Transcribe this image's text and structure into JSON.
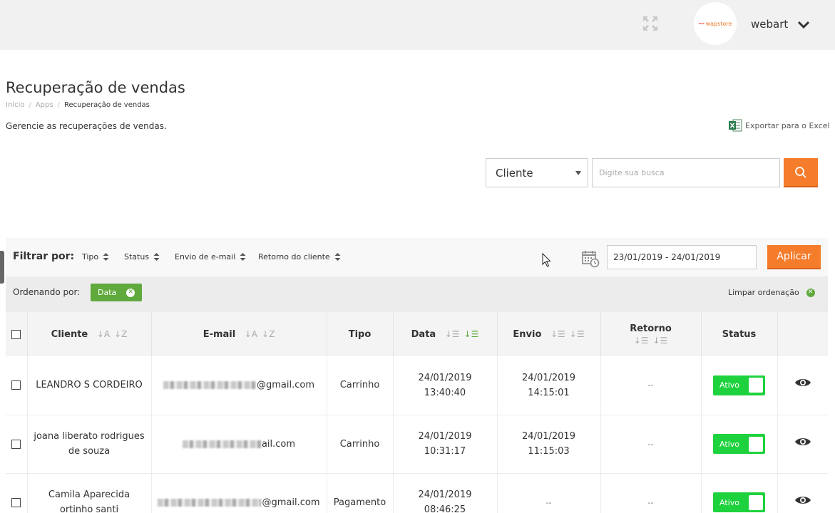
{
  "header": {
    "logo_text": "wapstore",
    "username": "webart"
  },
  "page": {
    "title": "Recuperação de vendas",
    "breadcrumb": [
      "Início",
      "Apps",
      "Recuperação de vendas"
    ],
    "subtitle": "Gerencie as recuperações de vendas.",
    "export_label": "Exportar para o Excel"
  },
  "search": {
    "select_value": "Cliente",
    "placeholder": "Digite sua busca"
  },
  "filters": {
    "label": "Filtrar por:",
    "items": [
      "Tipo",
      "Status",
      "Envio de e-mail",
      "Retorno do cliente"
    ],
    "date_range": "23/01/2019 - 24/01/2019",
    "apply_label": "Aplicar"
  },
  "sorting": {
    "label": "Ordenando por:",
    "active": "Data",
    "clear_label": "Limpar ordenação"
  },
  "table": {
    "headers": {
      "cliente": "Cliente",
      "email": "E-mail",
      "tipo": "Tipo",
      "data": "Data",
      "envio": "Envio",
      "retorno": "Retorno",
      "status": "Status"
    },
    "rows": [
      {
        "cliente": "LEANDRO S CORDEIRO",
        "email_suffix": "@gmail.com",
        "tipo": "Carrinho",
        "data_date": "24/01/2019",
        "data_time": "13:40:40",
        "envio_date": "24/01/2019",
        "envio_time": "14:15:01",
        "retorno": "--",
        "status": "Ativo"
      },
      {
        "cliente": "joana liberato rodrigues de souza",
        "email_suffix": "ail.com",
        "tipo": "Carrinho",
        "data_date": "24/01/2019",
        "data_time": "10:31:17",
        "envio_date": "24/01/2019",
        "envio_time": "11:15:03",
        "retorno": "--",
        "status": "Ativo"
      },
      {
        "cliente": "Camila Aparecida ortinho santi",
        "email_suffix": "@gmail.com",
        "tipo": "Pagamento",
        "data_date": "24/01/2019",
        "data_time": "08:46:25",
        "envio_date": "--",
        "envio_time": "",
        "retorno": "--",
        "status": "Ativo"
      }
    ]
  },
  "colors": {
    "accent_orange": "#f57c2b",
    "chip_green": "#5fa93d",
    "toggle_green": "#1ed23d"
  }
}
